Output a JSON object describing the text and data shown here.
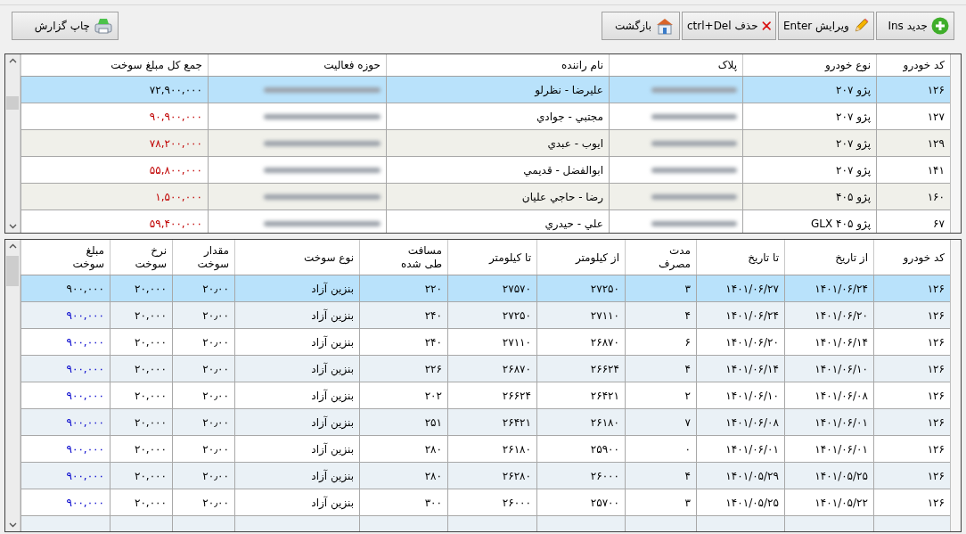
{
  "toolbar": {
    "buttons": [
      {
        "label": "جدید Ins",
        "kind": "add"
      },
      {
        "label": "ویرایش Enter",
        "kind": "edit"
      },
      {
        "label": "حذف ctrl+Del",
        "kind": "delete"
      },
      {
        "label": "بازگشت",
        "kind": "back"
      }
    ],
    "print_button": {
      "label": "چاپ گزارش",
      "kind": "print"
    }
  },
  "vehicles_table": {
    "columns": [
      {
        "label": "کد خودرو",
        "kind": "text"
      },
      {
        "label": "نوع خودرو",
        "kind": "text"
      },
      {
        "label": "پلاک",
        "kind": "blurred"
      },
      {
        "label": "نام راننده",
        "kind": "text"
      },
      {
        "label": "حوزه فعالیت",
        "kind": "blurred"
      },
      {
        "label": "جمع کل مبلغ سوخت",
        "kind": "amount"
      }
    ],
    "rows": [
      {
        "selected": true,
        "cells": [
          "۱۲۶",
          "پژو ۲۰۷",
          "",
          "علیرضا - نظرلو",
          "",
          "۷۲,۹۰۰,۰۰۰"
        ]
      },
      {
        "selected": false,
        "cells": [
          "۱۲۷",
          "پژو ۲۰۷",
          "",
          "مجتبي - جوادي",
          "",
          "۹۰,۹۰۰,۰۰۰"
        ]
      },
      {
        "selected": false,
        "cells": [
          "۱۲۹",
          "پژو ۲۰۷",
          "",
          "ايوب - عبدي",
          "",
          "۷۸,۲۰۰,۰۰۰"
        ]
      },
      {
        "selected": false,
        "cells": [
          "۱۴۱",
          "پژو ۲۰۷",
          "",
          "ابوالفضل - قديمي",
          "",
          "۵۵,۸۰۰,۰۰۰"
        ]
      },
      {
        "selected": false,
        "cells": [
          "۱۶۰",
          "پژو ۴۰۵",
          "",
          "رضا - حاجي عليان",
          "",
          "۱,۵۰۰,۰۰۰"
        ]
      },
      {
        "selected": false,
        "cells": [
          "۶۷",
          "پژو ۴۰۵ GLX",
          "",
          "علي - حيدري",
          "",
          "۵۹,۴۰۰,۰۰۰"
        ]
      }
    ]
  },
  "fuel_table": {
    "columns": [
      {
        "label": "کد خودرو",
        "kind": "text"
      },
      {
        "label": "از تاریخ",
        "kind": "text"
      },
      {
        "label": "تا تاریخ",
        "kind": "text"
      },
      {
        "label": "مدت مصرف",
        "kind": "text"
      },
      {
        "label": "از کیلومتر",
        "kind": "text"
      },
      {
        "label": "تا کیلومتر",
        "kind": "text"
      },
      {
        "label": "مسافت طی شده",
        "kind": "text"
      },
      {
        "label": "نوع سوخت",
        "kind": "text"
      },
      {
        "label": "مقدار سوخت",
        "kind": "text"
      },
      {
        "label": "نرخ سوخت",
        "kind": "text"
      },
      {
        "label": "مبلغ سوخت",
        "kind": "amount"
      }
    ],
    "rows": [
      {
        "selected": true,
        "cells": [
          "۱۲۶",
          "۱۴۰۱/۰۶/۲۴",
          "۱۴۰۱/۰۶/۲۷",
          "۳",
          "۲۷۲۵۰",
          "۲۷۵۷۰",
          "۲۲۰",
          "بنزین آزاد",
          "۲۰٫۰۰",
          "۲۰,۰۰۰",
          "۹۰۰,۰۰۰"
        ]
      },
      {
        "selected": false,
        "cells": [
          "۱۲۶",
          "۱۴۰۱/۰۶/۲۰",
          "۱۴۰۱/۰۶/۲۴",
          "۴",
          "۲۷۱۱۰",
          "۲۷۲۵۰",
          "۲۴۰",
          "بنزین آزاد",
          "۲۰٫۰۰",
          "۲۰,۰۰۰",
          "۹۰۰,۰۰۰"
        ]
      },
      {
        "selected": false,
        "cells": [
          "۱۲۶",
          "۱۴۰۱/۰۶/۱۴",
          "۱۴۰۱/۰۶/۲۰",
          "۶",
          "۲۶۸۷۰",
          "۲۷۱۱۰",
          "۲۴۰",
          "بنزین آزاد",
          "۲۰٫۰۰",
          "۲۰,۰۰۰",
          "۹۰۰,۰۰۰"
        ]
      },
      {
        "selected": false,
        "cells": [
          "۱۲۶",
          "۱۴۰۱/۰۶/۱۰",
          "۱۴۰۱/۰۶/۱۴",
          "۴",
          "۲۶۶۲۴",
          "۲۶۸۷۰",
          "۲۲۶",
          "بنزین آزاد",
          "۲۰٫۰۰",
          "۲۰,۰۰۰",
          "۹۰۰,۰۰۰"
        ]
      },
      {
        "selected": false,
        "cells": [
          "۱۲۶",
          "۱۴۰۱/۰۶/۰۸",
          "۱۴۰۱/۰۶/۱۰",
          "۲",
          "۲۶۴۲۱",
          "۲۶۶۲۴",
          "۲۰۲",
          "بنزین آزاد",
          "۲۰٫۰۰",
          "۲۰,۰۰۰",
          "۹۰۰,۰۰۰"
        ]
      },
      {
        "selected": false,
        "cells": [
          "۱۲۶",
          "۱۴۰۱/۰۶/۰۱",
          "۱۴۰۱/۰۶/۰۸",
          "۷",
          "۲۶۱۸۰",
          "۲۶۴۲۱",
          "۲۵۱",
          "بنزین آزاد",
          "۲۰٫۰۰",
          "۲۰,۰۰۰",
          "۹۰۰,۰۰۰"
        ]
      },
      {
        "selected": false,
        "cells": [
          "۱۲۶",
          "۱۴۰۱/۰۶/۰۱",
          "۱۴۰۱/۰۶/۰۱",
          "۰",
          "۲۵۹۰۰",
          "۲۶۱۸۰",
          "۲۸۰",
          "بنزین آزاد",
          "۲۰٫۰۰",
          "۲۰,۰۰۰",
          "۹۰۰,۰۰۰"
        ]
      },
      {
        "selected": false,
        "cells": [
          "۱۲۶",
          "۱۴۰۱/۰۵/۲۵",
          "۱۴۰۱/۰۵/۲۹",
          "۴",
          "۲۶۰۰۰",
          "۲۶۲۸۰",
          "۲۸۰",
          "بنزین آزاد",
          "۲۰٫۰۰",
          "۲۰,۰۰۰",
          "۹۰۰,۰۰۰"
        ]
      },
      {
        "selected": false,
        "cells": [
          "۱۲۶",
          "۱۴۰۱/۰۵/۲۲",
          "۱۴۰۱/۰۵/۲۵",
          "۳",
          "۲۵۷۰۰",
          "۲۶۰۰۰",
          "۳۰۰",
          "بنزین آزاد",
          "۲۰٫۰۰",
          "۲۰,۰۰۰",
          "۹۰۰,۰۰۰"
        ]
      }
    ]
  }
}
